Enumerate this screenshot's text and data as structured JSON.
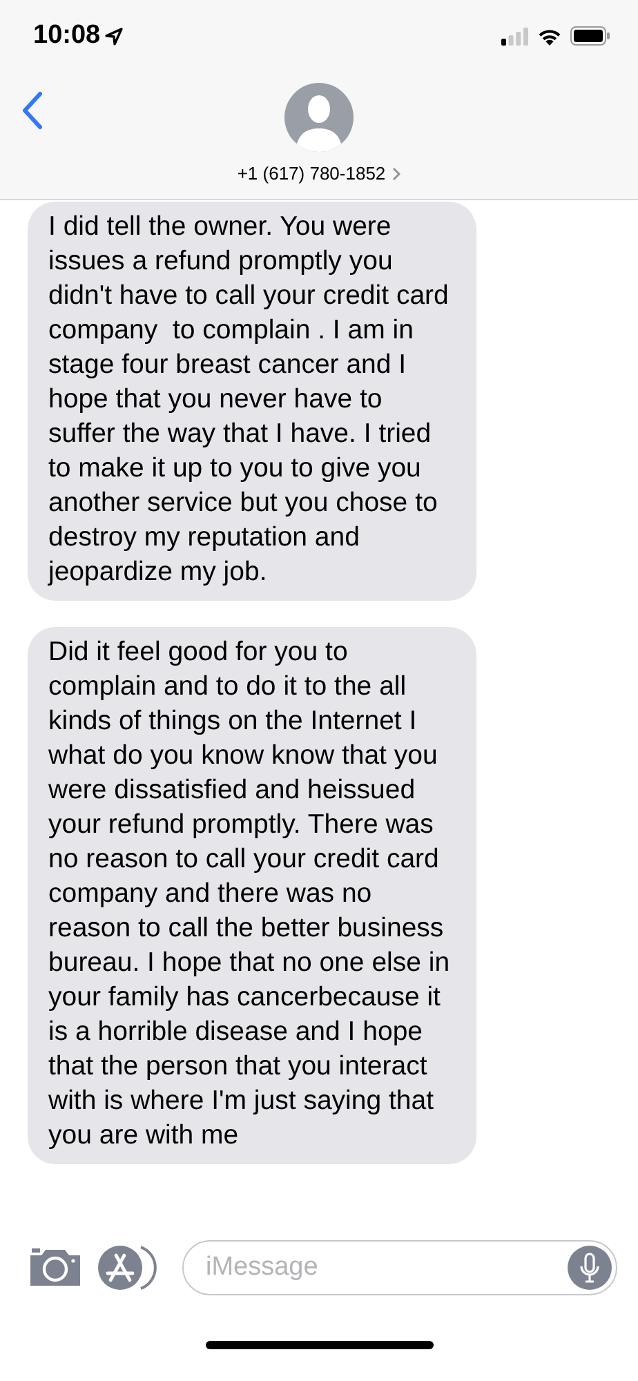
{
  "status_bar": {
    "time": "10:08"
  },
  "header": {
    "contact": "+1 (617) 780-1852"
  },
  "messages": [
    {
      "kind": "incoming",
      "text": "I did tell the owner. You were issues a refund promptly you didn't have to call your credit card company  to complain . I am in stage four breast cancer and I hope that you never have to suffer the way that I have. I tried to make it up to you to give you another service but you chose to destroy my reputation and jeopardize my job."
    },
    {
      "kind": "incoming",
      "text": "Did it feel good for you to complain and to do it to the all kinds of things on the Internet I what do you know know that you were dissatisfied and heissued your refund promptly. There was no reason to call your credit card company and there was no reason to call the better business bureau. I hope that no one else in your family has cancerbecause it is a horrible disease and I hope that the person that you interact with is where I'm just saying that you are with me"
    }
  ],
  "composer": {
    "placeholder": "iMessage"
  }
}
